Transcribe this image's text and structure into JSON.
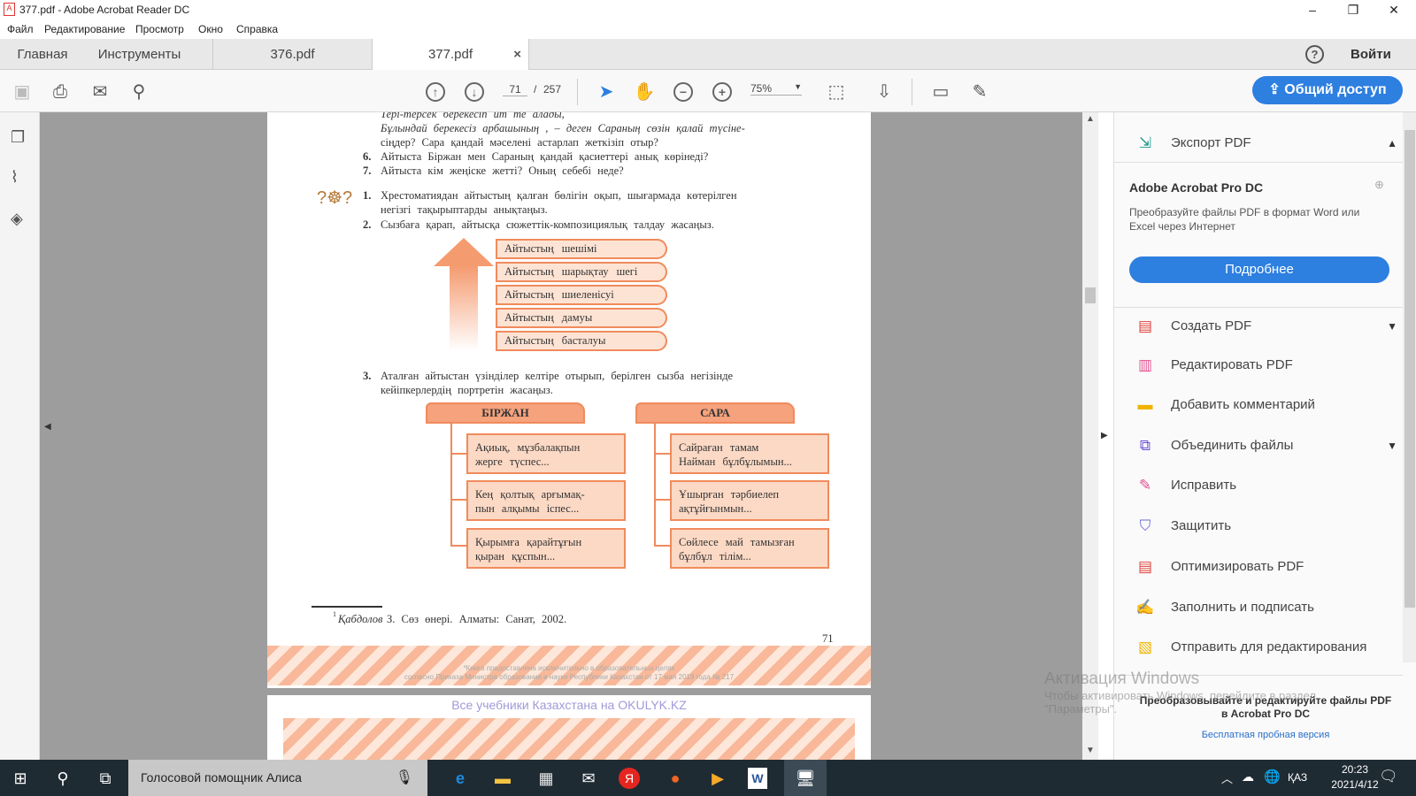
{
  "window": {
    "title": "377.pdf - Adobe Acrobat Reader DC",
    "icon": "pdf-icon"
  },
  "menu": [
    "Файл",
    "Редактирование",
    "Просмотр",
    "Окно",
    "Справка"
  ],
  "tabs": {
    "home": "Главная",
    "tools": "Инструменты",
    "doc1": "376.pdf",
    "doc2": "377.pdf",
    "close": "×",
    "help": "?",
    "login": "Войти"
  },
  "toolbar": {
    "page_current": "71",
    "page_sep": "/",
    "page_total": "257",
    "zoom": "75%",
    "share": "Общий доступ"
  },
  "document": {
    "lines_top": [
      "Тері-терсек   берекесіп   ит   те   алады,",
      "Бұлындай   берекесіз   арбашының  , – деген Сараның  сөзін  қалай  түсіне-",
      "сіңдер?  Сара  қандай   мәселені   астарлап   жеткізіп   отыр?"
    ],
    "q6": {
      "num": "6.",
      "text": "Айтыста   Біржан   мен  Сараның   қандай   қасиеттері   анық  көрінеді?"
    },
    "q7": {
      "num": "7.",
      "text": "Айтыста   кім  жеңіске   жетті?   Оның  себебі  неде?"
    },
    "t1": {
      "num": "1.",
      "line1": "Хрестоматиядан    айтыстың   қалған  бөлігін  оқып,  шығармада   көтерілген",
      "line2": "негізгі   тақырыптарды    анықтаңыз."
    },
    "t2": {
      "num": "2.",
      "text": "Сызбаға   қарап,   айтысқа   сюжеттік-композициялық        талдау  жасаңыз."
    },
    "stages": [
      "Айтыстың   шешімі",
      "Айтыстың   шарықтау   шегі",
      "Айтыстың   шиеленісуі",
      "Айтыстың   дамуы",
      "Айтыстың   басталуы"
    ],
    "t3": {
      "num": "3.",
      "line1": "Аталған   айтыстан   үзінділер   келтіре   отырып,   берілген   сызба  негізінде",
      "line2": "кейіпкерлердің     портретін   жасаңыз."
    },
    "birzhan": {
      "title": "БІРЖАН",
      "items": [
        [
          "Ақиық,   мұзбалақпын",
          "жерге   түспес..."
        ],
        [
          "Кең   қолтық   арғымақ-",
          "пын  алқымы   іспес..."
        ],
        [
          "Қырымға   қарайтұғын",
          "қыран   құспын..."
        ]
      ]
    },
    "sara": {
      "title": "САРА",
      "items": [
        [
          "Сайраған   тамам",
          "Найман   бұлбұлымын..."
        ],
        [
          "Ұшырған   тәрбиелеп",
          "ақтұйғынмын..."
        ],
        [
          "Сөйлесе  май  тамызған",
          "бұлбұл   тілім..."
        ]
      ]
    },
    "footnote": {
      "sup": "1",
      "author": "Қабдолов",
      "text": "  З. Сөз  өнері.  Алматы:   Санат,   2002."
    },
    "page_number": "71",
    "watermark1": "*Книга предоставлена исключительно в образовательных целях",
    "watermark2": "согласно Приказа Министра образования и науки Республики Казахстан от 17 мая 2019 года № 217",
    "banner": "Все учебники Казахстана на OKULYK.KZ"
  },
  "right_panel": {
    "export": {
      "label": "Экспорт PDF",
      "icon": "export-pdf-icon"
    },
    "promo_title": "Adobe Acrobat Pro DC",
    "promo_desc1": "Преобразуйте файлы PDF в формат Word или",
    "promo_desc2": "Excel через Интернет",
    "more": "Подробнее",
    "tools": [
      {
        "label": "Создать PDF",
        "icon": "create-pdf-icon",
        "color": "#e0413c",
        "chevron": true
      },
      {
        "label": "Редактировать PDF",
        "icon": "edit-pdf-icon",
        "color": "#e24f8e",
        "chevron": false
      },
      {
        "label": "Добавить комментарий",
        "icon": "comment-icon",
        "color": "#f0b400",
        "chevron": false
      },
      {
        "label": "Объединить файлы",
        "icon": "combine-files-icon",
        "color": "#6b4fd8",
        "chevron": true
      },
      {
        "label": "Исправить",
        "icon": "fix-icon",
        "color": "#e24f8e",
        "chevron": false
      },
      {
        "label": "Защитить",
        "icon": "protect-shield-icon",
        "color": "#6b6bd8",
        "chevron": false
      },
      {
        "label": "Оптимизировать PDF",
        "icon": "optimize-pdf-icon",
        "color": "#e0413c",
        "chevron": false
      },
      {
        "label": "Заполнить и подписать",
        "icon": "fill-sign-icon",
        "color": "#8a4fd8",
        "chevron": false
      },
      {
        "label": "Отправить для редактирования",
        "icon": "send-review-icon",
        "color": "#f0b400",
        "chevron": false
      }
    ],
    "footer_title1": "Преобразовывайте и редактируйте файлы PDF",
    "footer_title2": "в Acrobat Pro DC",
    "trial": "Бесплатная пробная версия"
  },
  "activation": {
    "title": "Активация Windows",
    "line1": "Чтобы активировать Windows, перейдите в раздел",
    "line2": "\"Параметры\"."
  },
  "taskbar": {
    "search": "Голосовой помощник Алиса",
    "lang": "ҚАЗ",
    "time": "20:23",
    "date": "2021/4/12"
  },
  "colors": {
    "accent": "#2d7fe0",
    "diagram": "#f08b5c",
    "taskbar": "#1f2b33"
  }
}
